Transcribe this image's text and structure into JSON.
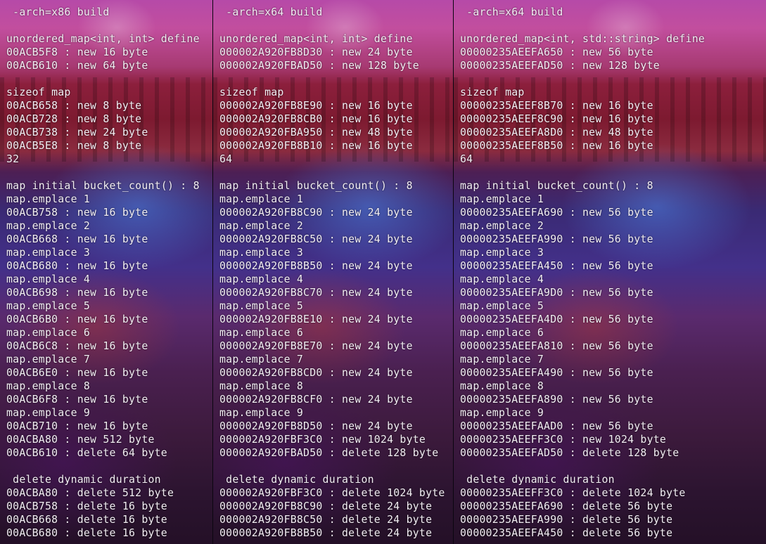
{
  "panes": [
    {
      "lines": [
        " -arch=x86 build",
        "",
        "unordered_map<int, int> define",
        "00ACB5F8 : new 16 byte",
        "00ACB610 : new 64 byte",
        "",
        "sizeof map",
        "00ACB658 : new 8 byte",
        "00ACB728 : new 8 byte",
        "00ACB738 : new 24 byte",
        "00ACB5E8 : new 8 byte",
        "32",
        "",
        "map initial bucket_count() : 8",
        "map.emplace 1",
        "00ACB758 : new 16 byte",
        "map.emplace 2",
        "00ACB668 : new 16 byte",
        "map.emplace 3",
        "00ACB680 : new 16 byte",
        "map.emplace 4",
        "00ACB698 : new 16 byte",
        "map.emplace 5",
        "00ACB6B0 : new 16 byte",
        "map.emplace 6",
        "00ACB6C8 : new 16 byte",
        "map.emplace 7",
        "00ACB6E0 : new 16 byte",
        "map.emplace 8",
        "00ACB6F8 : new 16 byte",
        "map.emplace 9",
        "00ACB710 : new 16 byte",
        "00ACBA80 : new 512 byte",
        "00ACB610 : delete 64 byte",
        "",
        " delete dynamic duration",
        "00ACBA80 : delete 512 byte",
        "00ACB758 : delete 16 byte",
        "00ACB668 : delete 16 byte",
        "00ACB680 : delete 16 byte"
      ]
    },
    {
      "lines": [
        " -arch=x64 build",
        "",
        "unordered_map<int, int> define",
        "000002A920FB8D30 : new 24 byte",
        "000002A920FBAD50 : new 128 byte",
        "",
        "sizeof map",
        "000002A920FB8E90 : new 16 byte",
        "000002A920FB8CB0 : new 16 byte",
        "000002A920FBA950 : new 48 byte",
        "000002A920FB8B10 : new 16 byte",
        "64",
        "",
        "map initial bucket_count() : 8",
        "map.emplace 1",
        "000002A920FB8C90 : new 24 byte",
        "map.emplace 2",
        "000002A920FB8C50 : new 24 byte",
        "map.emplace 3",
        "000002A920FB8B50 : new 24 byte",
        "map.emplace 4",
        "000002A920FB8C70 : new 24 byte",
        "map.emplace 5",
        "000002A920FB8E10 : new 24 byte",
        "map.emplace 6",
        "000002A920FB8E70 : new 24 byte",
        "map.emplace 7",
        "000002A920FB8CD0 : new 24 byte",
        "map.emplace 8",
        "000002A920FB8CF0 : new 24 byte",
        "map.emplace 9",
        "000002A920FB8D50 : new 24 byte",
        "000002A920FBF3C0 : new 1024 byte",
        "000002A920FBAD50 : delete 128 byte",
        "",
        " delete dynamic duration",
        "000002A920FBF3C0 : delete 1024 byte",
        "000002A920FB8C90 : delete 24 byte",
        "000002A920FB8C50 : delete 24 byte",
        "000002A920FB8B50 : delete 24 byte"
      ]
    },
    {
      "lines": [
        " -arch=x64 build",
        "",
        "unordered_map<int, std::string> define",
        "00000235AEEFA650 : new 56 byte",
        "00000235AEEFAD50 : new 128 byte",
        "",
        "sizeof map",
        "00000235AEEF8B70 : new 16 byte",
        "00000235AEEF8C90 : new 16 byte",
        "00000235AEEFA8D0 : new 48 byte",
        "00000235AEEF8B50 : new 16 byte",
        "64",
        "",
        "map initial bucket_count() : 8",
        "map.emplace 1",
        "00000235AEEFA690 : new 56 byte",
        "map.emplace 2",
        "00000235AEEFA990 : new 56 byte",
        "map.emplace 3",
        "00000235AEEFA450 : new 56 byte",
        "map.emplace 4",
        "00000235AEEFA9D0 : new 56 byte",
        "map.emplace 5",
        "00000235AEEFA4D0 : new 56 byte",
        "map.emplace 6",
        "00000235AEEFA810 : new 56 byte",
        "map.emplace 7",
        "00000235AEEFA490 : new 56 byte",
        "map.emplace 8",
        "00000235AEEFA890 : new 56 byte",
        "map.emplace 9",
        "00000235AEEFAAD0 : new 56 byte",
        "00000235AEEFF3C0 : new 1024 byte",
        "00000235AEEFAD50 : delete 128 byte",
        "",
        " delete dynamic duration",
        "00000235AEEFF3C0 : delete 1024 byte",
        "00000235AEEFA690 : delete 56 byte",
        "00000235AEEFA990 : delete 56 byte",
        "00000235AEEFA450 : delete 56 byte"
      ]
    }
  ]
}
